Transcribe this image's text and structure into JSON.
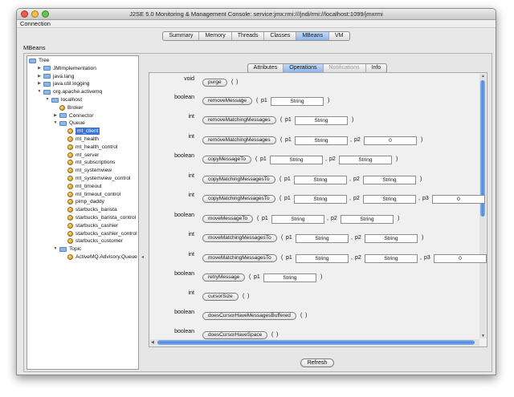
{
  "window": {
    "title": "J2SE 5.0 Monitoring & Management Console: service:jmx:rmi:///jndi/rmi://localhost:1099/jmxrmi",
    "traffic_lights": {
      "close": "#f25950",
      "minimize": "#f7c03b",
      "zoom": "#5ec94a"
    }
  },
  "menu": {
    "connection": "Connection"
  },
  "main_tabs": [
    "Summary",
    "Memory",
    "Threads",
    "Classes",
    "MBeans",
    "VM"
  ],
  "main_tab_selected": "MBeans",
  "mbeans_label": "MBeans",
  "tree": [
    {
      "label": "Tree",
      "depth": 0,
      "kind": "folder",
      "expand": ""
    },
    {
      "label": "JMImplementation",
      "depth": 1,
      "kind": "folder",
      "expand": "collapsed"
    },
    {
      "label": "java.lang",
      "depth": 1,
      "kind": "folder",
      "expand": "collapsed"
    },
    {
      "label": "java.util.logging",
      "depth": 1,
      "kind": "folder",
      "expand": "collapsed"
    },
    {
      "label": "org.apache.activemq",
      "depth": 1,
      "kind": "folder",
      "expand": "expanded"
    },
    {
      "label": "localhost",
      "depth": 2,
      "kind": "folder",
      "expand": "expanded"
    },
    {
      "label": "Broker",
      "depth": 3,
      "kind": "bean",
      "expand": ""
    },
    {
      "label": "Connector",
      "depth": 3,
      "kind": "folder",
      "expand": "collapsed"
    },
    {
      "label": "Queue",
      "depth": 3,
      "kind": "folder",
      "expand": "expanded"
    },
    {
      "label": "mt_client",
      "depth": 4,
      "kind": "bean",
      "expand": "",
      "selected": true
    },
    {
      "label": "mt_health",
      "depth": 4,
      "kind": "bean",
      "expand": ""
    },
    {
      "label": "mt_health_control",
      "depth": 4,
      "kind": "bean",
      "expand": ""
    },
    {
      "label": "mt_server",
      "depth": 4,
      "kind": "bean",
      "expand": ""
    },
    {
      "label": "mt_subscriptions",
      "depth": 4,
      "kind": "bean",
      "expand": ""
    },
    {
      "label": "mt_systemview",
      "depth": 4,
      "kind": "bean",
      "expand": ""
    },
    {
      "label": "mt_systemview_control",
      "depth": 4,
      "kind": "bean",
      "expand": ""
    },
    {
      "label": "mt_timeout",
      "depth": 4,
      "kind": "bean",
      "expand": ""
    },
    {
      "label": "mt_timeout_control",
      "depth": 4,
      "kind": "bean",
      "expand": ""
    },
    {
      "label": "pimp_daddy",
      "depth": 4,
      "kind": "bean",
      "expand": ""
    },
    {
      "label": "starbucks_barista",
      "depth": 4,
      "kind": "bean",
      "expand": ""
    },
    {
      "label": "starbucks_barista_control",
      "depth": 4,
      "kind": "bean",
      "expand": ""
    },
    {
      "label": "starbucks_cashier",
      "depth": 4,
      "kind": "bean",
      "expand": ""
    },
    {
      "label": "starbucks_cashier_control",
      "depth": 4,
      "kind": "bean",
      "expand": ""
    },
    {
      "label": "starbucks_customer",
      "depth": 4,
      "kind": "bean",
      "expand": ""
    },
    {
      "label": "Topic",
      "depth": 3,
      "kind": "folder",
      "expand": "expanded"
    },
    {
      "label": "ActiveMQ.Advisory.Queue",
      "depth": 4,
      "kind": "bean",
      "expand": ""
    }
  ],
  "sub_tabs": [
    {
      "label": "Attributes",
      "state": "normal"
    },
    {
      "label": "Operations",
      "state": "selected"
    },
    {
      "label": "Notifications",
      "state": "disabled"
    },
    {
      "label": "Info",
      "state": "normal"
    }
  ],
  "operations": [
    {
      "type": "void",
      "name": "purge",
      "params": []
    },
    {
      "type": "boolean",
      "name": "removeMessage",
      "params": [
        {
          "label": "p1",
          "value": "String"
        }
      ]
    },
    {
      "type": "int",
      "name": "removeMatchingMessages",
      "params": [
        {
          "label": "p1",
          "value": "String"
        }
      ]
    },
    {
      "type": "int",
      "name": "removeMatchingMessages",
      "params": [
        {
          "label": "p1",
          "value": "String"
        },
        {
          "label": "p2",
          "value": "0"
        }
      ]
    },
    {
      "type": "boolean",
      "name": "copyMessageTo",
      "params": [
        {
          "label": "p1",
          "value": "String"
        },
        {
          "label": "p2",
          "value": "String"
        }
      ]
    },
    {
      "type": "int",
      "name": "copyMatchingMessagesTo",
      "params": [
        {
          "label": "p1",
          "value": "String"
        },
        {
          "label": "p2",
          "value": "String"
        }
      ]
    },
    {
      "type": "int",
      "name": "copyMatchingMessagesTo",
      "params": [
        {
          "label": "p1",
          "value": "String"
        },
        {
          "label": "p2",
          "value": "String"
        },
        {
          "label": "p3",
          "value": "0"
        }
      ]
    },
    {
      "type": "boolean",
      "name": "moveMessageTo",
      "params": [
        {
          "label": "p1",
          "value": "String"
        },
        {
          "label": "p2",
          "value": "String"
        }
      ]
    },
    {
      "type": "int",
      "name": "moveMatchingMessagesTo",
      "params": [
        {
          "label": "p1",
          "value": "String"
        },
        {
          "label": "p2",
          "value": "String"
        }
      ]
    },
    {
      "type": "int",
      "name": "moveMatchingMessagesTo",
      "params": [
        {
          "label": "p1",
          "value": "String"
        },
        {
          "label": "p2",
          "value": "String"
        },
        {
          "label": "p3",
          "value": "0"
        }
      ]
    },
    {
      "type": "boolean",
      "name": "retryMessage",
      "params": [
        {
          "label": "p1",
          "value": "String"
        }
      ]
    },
    {
      "type": "int",
      "name": "cursorSize",
      "params": []
    },
    {
      "type": "boolean",
      "name": "doesCursorHaveMessagesBuffered",
      "params": []
    },
    {
      "type": "boolean",
      "name": "doesCursorHaveSpace",
      "params": []
    }
  ],
  "refresh_label": "Refresh"
}
